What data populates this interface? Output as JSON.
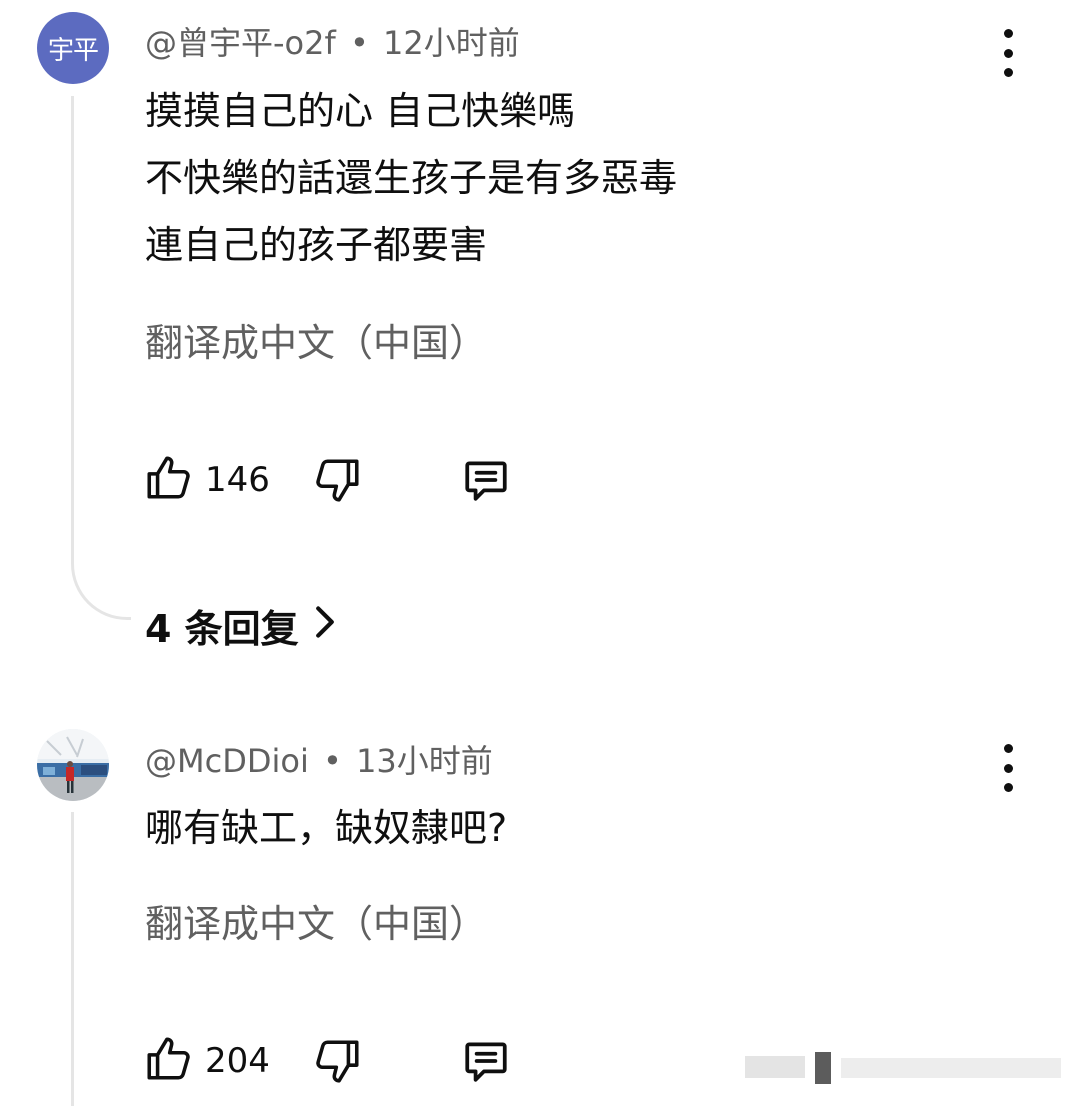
{
  "comments": [
    {
      "avatar_text": "宇平",
      "author": "@曾宇平-o2f",
      "time": "12小时前",
      "lines": [
        "摸摸自己的心  自己快樂嗎",
        "不快樂的話還生孩子是有多惡毒",
        "連自己的孩子都要害"
      ],
      "translate": "翻译成中文（中国）",
      "likes": "146",
      "replies": "4 条回复"
    },
    {
      "author": "@McDDioi",
      "time": "13小时前",
      "lines": [
        "哪有缺工，缺奴隸吧?"
      ],
      "translate": "翻译成中文（中国）",
      "likes": "204"
    }
  ],
  "separator": "•",
  "colors": {
    "avatar_bg": "#5c6bc0",
    "secondary_text": "#606060",
    "thread_line": "#e5e5e5"
  }
}
